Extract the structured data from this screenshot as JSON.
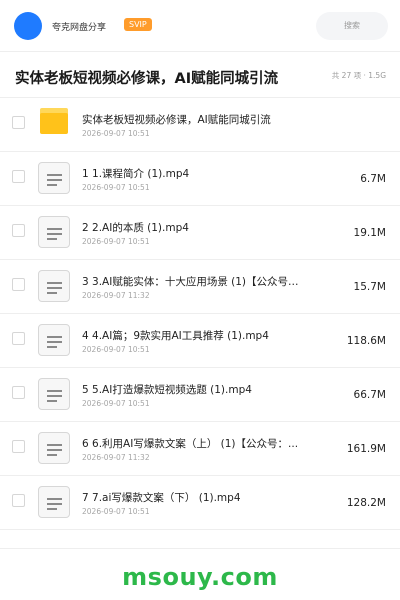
{
  "header": {
    "share_name": "夸克网盘分享",
    "badge": "SVIP",
    "search_label": "搜索",
    "avatar_color": "#1f7bff",
    "badge_color": "#ff9c2b"
  },
  "folder": {
    "title": "实体老板短视频必修课，AI赋能同城引流",
    "count": "共 27 项 · 1.5G"
  },
  "files": [
    {
      "name": "实体老板短视频必修课，AI赋能同城引流",
      "date": "2026-09-07 10:51",
      "size": "",
      "icon": "folder-icon"
    },
    {
      "name": "1 1.课程简介 (1).mp4",
      "date": "2026-09-07 10:51",
      "size": "6.7M",
      "icon": "file-icon"
    },
    {
      "name": "2 2.AI的本质 (1).mp4",
      "date": "2026-09-07 10:51",
      "size": "19.1M",
      "icon": "file-icon"
    },
    {
      "name": "3 3.AI赋能实体：十大应用场景 (1)【公众号：...",
      "date": "2026-09-07 11:32",
      "size": "15.7M",
      "icon": "file-icon"
    },
    {
      "name": "4 4.AI篇；9款实用AI工具推荐 (1).mp4",
      "date": "2026-09-07 10:51",
      "size": "118.6M",
      "icon": "file-icon"
    },
    {
      "name": "5 5.AI打造爆款短视频选题 (1).mp4",
      "date": "2026-09-07 10:51",
      "size": "66.7M",
      "icon": "file-icon"
    },
    {
      "name": "6 6.利用AI写爆款文案（上） (1)【公众号：...",
      "date": "2026-09-07 11:32",
      "size": "161.9M",
      "icon": "file-icon"
    },
    {
      "name": "7 7.ai写爆款文案（下） (1).mp4",
      "date": "2026-09-07 10:51",
      "size": "128.2M",
      "icon": "file-icon"
    }
  ],
  "watermark": {
    "text": "msouy.com",
    "color": "#2db84a"
  }
}
